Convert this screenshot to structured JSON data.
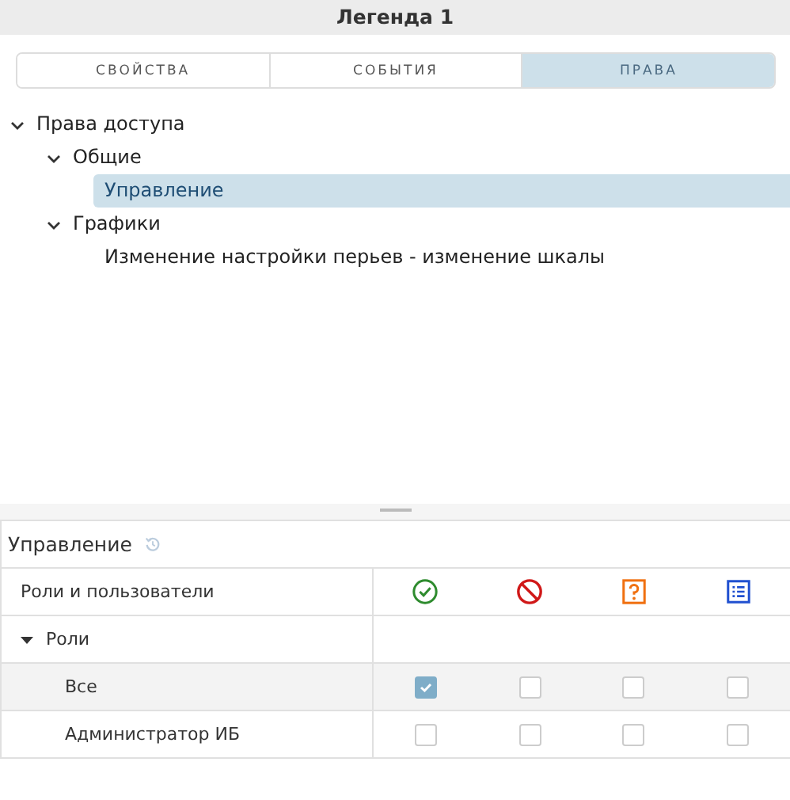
{
  "window": {
    "title": "Легенда 1"
  },
  "tabs": [
    {
      "label": "СВОЙСТВА",
      "selected": false
    },
    {
      "label": "СОБЫТИЯ",
      "selected": false
    },
    {
      "label": "ПРАВА",
      "selected": true
    }
  ],
  "tree": [
    {
      "label": "Права доступа",
      "expanded": true,
      "selected": false,
      "children": [
        {
          "label": "Общие",
          "expanded": true,
          "selected": false,
          "children": [
            {
              "label": "Управление",
              "selected": true
            }
          ]
        },
        {
          "label": "Графики",
          "expanded": true,
          "selected": false,
          "children": [
            {
              "label": "Изменение настройки перьев - изменение шкалы",
              "selected": false
            }
          ]
        }
      ]
    }
  ],
  "permissions": {
    "title": "Управление",
    "header": "Роли и пользователи",
    "columns": [
      {
        "kind": "allow"
      },
      {
        "kind": "deny"
      },
      {
        "kind": "ask"
      },
      {
        "kind": "list"
      }
    ],
    "rows": [
      {
        "kind": "group",
        "label": "Роли",
        "expanded": true,
        "selected": false
      },
      {
        "kind": "item",
        "label": "Все",
        "selected": true,
        "checks": [
          true,
          false,
          false,
          false
        ]
      },
      {
        "kind": "item",
        "label": "Администратор ИБ",
        "selected": false,
        "checks": [
          false,
          false,
          false,
          false
        ]
      }
    ]
  }
}
